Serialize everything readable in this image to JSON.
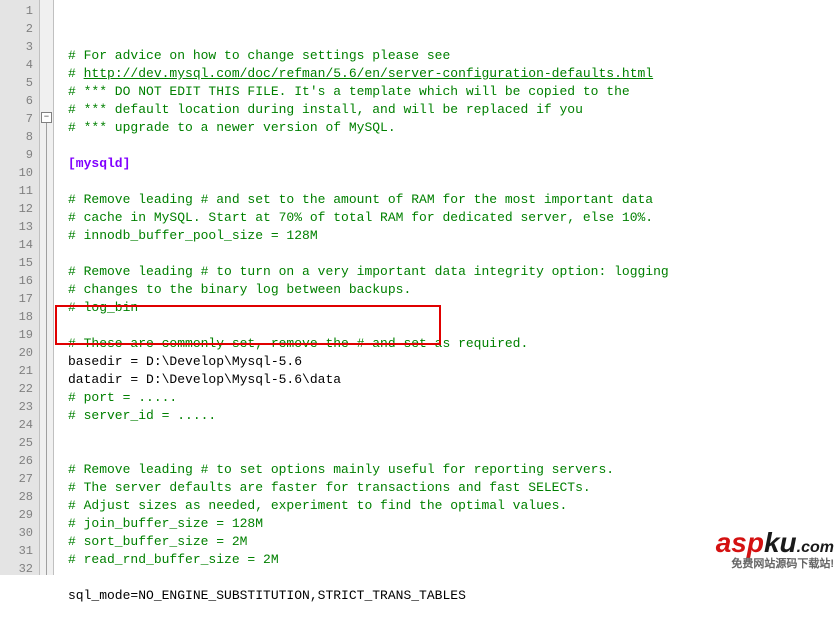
{
  "lines": [
    {
      "n": 1,
      "cls": "comment",
      "text": "# For advice on how to change settings please see"
    },
    {
      "n": 2,
      "cls": "comment",
      "text": "# ",
      "extra": {
        "cls": "comment underline",
        "text": "http://dev.mysql.com/doc/refman/5.6/en/server-configuration-defaults.html"
      }
    },
    {
      "n": 3,
      "cls": "comment",
      "text": "# *** DO NOT EDIT THIS FILE. It's a template which will be copied to the"
    },
    {
      "n": 4,
      "cls": "comment",
      "text": "# *** default location during install, and will be replaced if you"
    },
    {
      "n": 5,
      "cls": "comment",
      "text": "# *** upgrade to a newer version of MySQL."
    },
    {
      "n": 6,
      "cls": "",
      "text": ""
    },
    {
      "n": 7,
      "cls": "section",
      "text": "[mysqld]"
    },
    {
      "n": 8,
      "cls": "",
      "text": ""
    },
    {
      "n": 9,
      "cls": "comment",
      "text": "# Remove leading # and set to the amount of RAM for the most important data"
    },
    {
      "n": 10,
      "cls": "comment",
      "text": "# cache in MySQL. Start at 70% of total RAM for dedicated server, else 10%."
    },
    {
      "n": 11,
      "cls": "comment",
      "text": "# innodb_buffer_pool_size = 128M"
    },
    {
      "n": 12,
      "cls": "",
      "text": ""
    },
    {
      "n": 13,
      "cls": "comment",
      "text": "# Remove leading # to turn on a very important data integrity option: logging"
    },
    {
      "n": 14,
      "cls": "comment",
      "text": "# changes to the binary log between backups."
    },
    {
      "n": 15,
      "cls": "comment",
      "text": "# log_bin"
    },
    {
      "n": 16,
      "cls": "",
      "text": ""
    },
    {
      "n": 17,
      "cls": "comment",
      "text": "# These are commonly set, remove the # and set as required."
    },
    {
      "n": 18,
      "cls": "",
      "text": "basedir = D:\\Develop\\Mysql-5.6"
    },
    {
      "n": 19,
      "cls": "",
      "text": "datadir = D:\\Develop\\Mysql-5.6\\data"
    },
    {
      "n": 20,
      "cls": "comment",
      "text": "# port = ....."
    },
    {
      "n": 21,
      "cls": "comment",
      "text": "# server_id = ....."
    },
    {
      "n": 22,
      "cls": "",
      "text": ""
    },
    {
      "n": 23,
      "cls": "",
      "text": ""
    },
    {
      "n": 24,
      "cls": "comment",
      "text": "# Remove leading # to set options mainly useful for reporting servers."
    },
    {
      "n": 25,
      "cls": "comment",
      "text": "# The server defaults are faster for transactions and fast SELECTs."
    },
    {
      "n": 26,
      "cls": "comment",
      "text": "# Adjust sizes as needed, experiment to find the optimal values."
    },
    {
      "n": 27,
      "cls": "comment",
      "text": "# join_buffer_size = 128M"
    },
    {
      "n": 28,
      "cls": "comment",
      "text": "# sort_buffer_size = 2M"
    },
    {
      "n": 29,
      "cls": "comment",
      "text": "# read_rnd_buffer_size = 2M"
    },
    {
      "n": 30,
      "cls": "",
      "text": ""
    },
    {
      "n": 31,
      "cls": "",
      "text": "sql_mode=NO_ENGINE_SUBSTITUTION,STRICT_TRANS_TABLES"
    },
    {
      "n": 32,
      "cls": "",
      "text": ""
    }
  ],
  "fold_marker": "−",
  "watermark": {
    "a": "asp",
    "b": "ku",
    "c": ".com",
    "sub": "免费网站源码下载站!"
  }
}
